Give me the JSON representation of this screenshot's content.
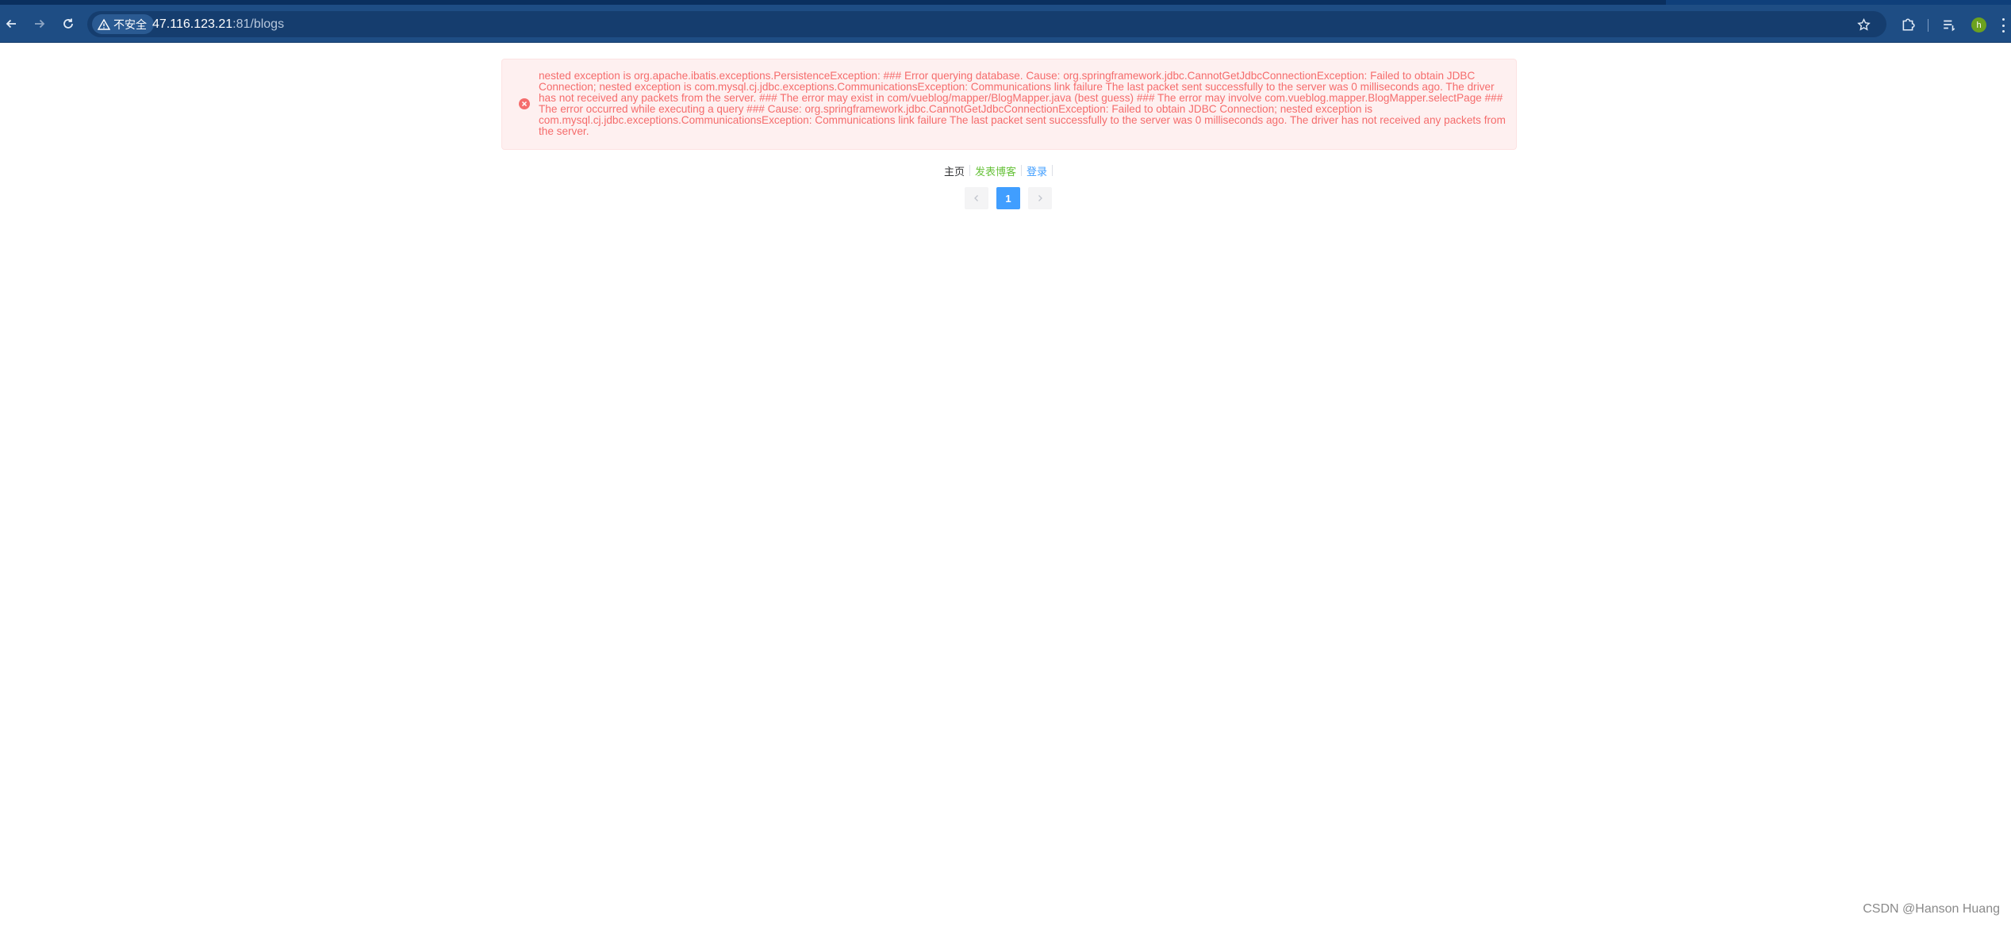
{
  "browser": {
    "security_label": "不安全",
    "url_host": "47.116.123.21",
    "url_rest": ":81/blogs",
    "avatar_letter": "h"
  },
  "alert": {
    "type": "error",
    "message": "nested exception is org.apache.ibatis.exceptions.PersistenceException: ### Error querying database. Cause: org.springframework.jdbc.CannotGetJdbcConnectionException: Failed to obtain JDBC Connection; nested exception is com.mysql.cj.jdbc.exceptions.CommunicationsException: Communications link failure The last packet sent successfully to the server was 0 milliseconds ago. The driver has not received any packets from the server. ### The error may exist in com/vueblog/mapper/BlogMapper.java (best guess) ### The error may involve com.vueblog.mapper.BlogMapper.selectPage ### The error occurred while executing a query ### Cause: org.springframework.jdbc.CannotGetJdbcConnectionException: Failed to obtain JDBC Connection; nested exception is com.mysql.cj.jdbc.exceptions.CommunicationsException: Communications link failure The last packet sent successfully to the server was 0 milliseconds ago. The driver has not received any packets from the server."
  },
  "nav": {
    "home": "主页",
    "publish": "发表博客",
    "login": "登录"
  },
  "pagination": {
    "current_page": "1"
  },
  "watermark": "CSDN @Hanson Huang",
  "colors": {
    "toolbar": "#1e4d84",
    "error_text": "#f56c6c",
    "error_bg": "#fef0f0",
    "primary": "#409eff",
    "success": "#67c23a"
  }
}
